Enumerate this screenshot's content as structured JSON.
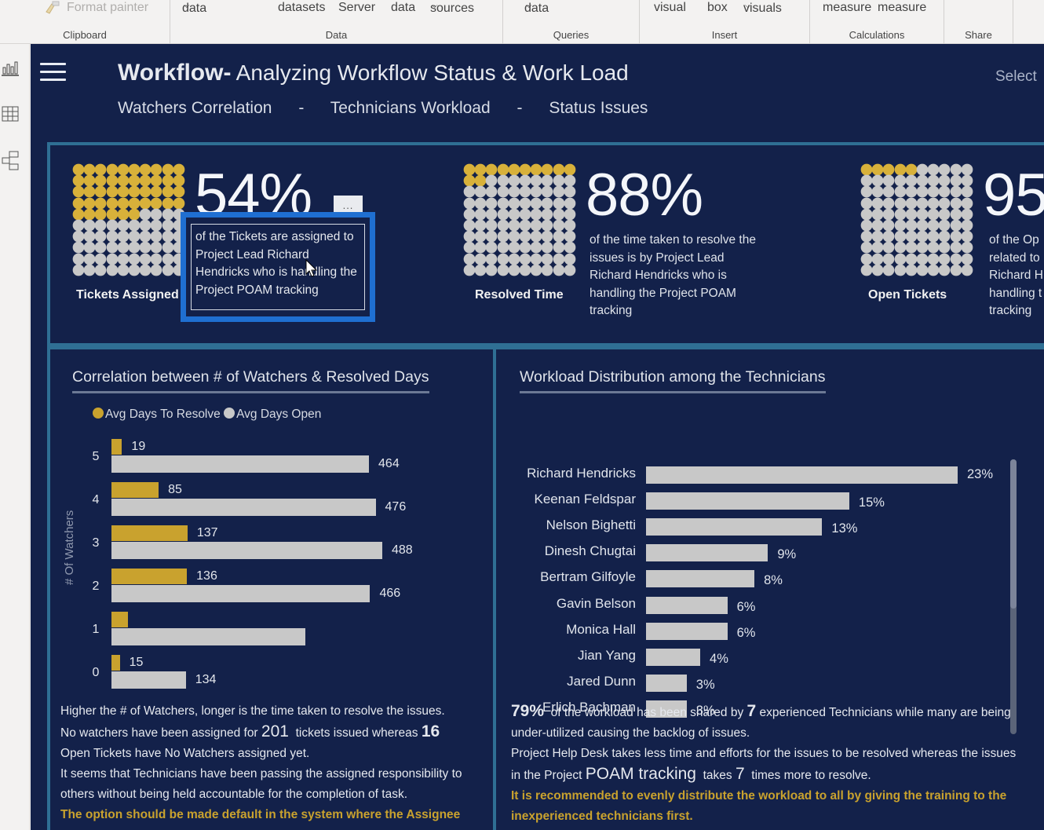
{
  "ribbon": {
    "groups": [
      {
        "label": "Clipboard",
        "items": [
          "Format painter"
        ]
      },
      {
        "label": "Data",
        "items": [
          "data",
          "datasets",
          "Server",
          "data",
          "sources"
        ]
      },
      {
        "label": "Queries",
        "items": [
          "data"
        ]
      },
      {
        "label": "Insert",
        "items": [
          "visual",
          "box",
          "visuals"
        ]
      },
      {
        "label": "Calculations",
        "items": [
          "measure",
          "measure"
        ]
      },
      {
        "label": "Share",
        "items": []
      }
    ]
  },
  "leftnav": {
    "items": [
      {
        "name": "report-view",
        "icon": "bar-chart-icon"
      },
      {
        "name": "data-view",
        "icon": "table-icon"
      },
      {
        "name": "model-view",
        "icon": "model-icon"
      }
    ]
  },
  "header": {
    "title_bold": "Workflow-",
    "title_rest": " Analyzing Workflow Status & Work Load",
    "nav": [
      "Watchers Correlation",
      "-",
      "Technicians Workload",
      "-",
      "Status Issues"
    ],
    "select_label": "Select"
  },
  "kpis": [
    {
      "label": "Tickets Assigned",
      "value": "54%",
      "waffle_filled_cells": 46,
      "waffle_total_cells": 100,
      "description": "of the Tickets are assigned to Project Lead Richard Hendricks who is handling the Project POAM tracking"
    },
    {
      "label": "Resolved Time",
      "value": "88%",
      "waffle_filled_cells": 12,
      "waffle_total_cells": 100,
      "description": "of the time taken to resolve the issues is by Project Lead Richard Hendricks who is handling the Project POAM tracking"
    },
    {
      "label": "Open Tickets",
      "value": "95",
      "waffle_filled_cells": 5,
      "waffle_total_cells": 100,
      "description_lines": [
        "of the Op",
        "related to",
        "Richard H",
        "handling t",
        "tracking"
      ]
    }
  ],
  "more_options_label": "...",
  "colors": {
    "background": "#13214a",
    "accent_border": "#2f6f94",
    "gold": "#c9a22e",
    "grey": "#c8c8c8",
    "focus_blue": "#1f6fd1"
  },
  "chart_data": [
    {
      "type": "bar",
      "orientation": "horizontal",
      "title": "Correlation between # of Watchers & Resolved Days",
      "ylabel": "# Of Watchers",
      "xlabel": "",
      "categories": [
        "5",
        "4",
        "3",
        "2",
        "1",
        "0"
      ],
      "series": [
        {
          "name": "Avg Days To Resolve",
          "color": "#c9a22e",
          "values": [
            19,
            85,
            137,
            136,
            30,
            15
          ],
          "labels": [
            "19",
            "85",
            "137",
            "136",
            "",
            "15"
          ]
        },
        {
          "name": "Avg Days Open",
          "color": "#c8c8c8",
          "values": [
            464,
            476,
            488,
            466,
            350,
            134
          ],
          "labels": [
            "464",
            "476",
            "488",
            "466",
            "",
            "134"
          ]
        }
      ],
      "xlim": [
        0,
        500
      ],
      "legend": "top-left",
      "grid": false
    },
    {
      "type": "bar",
      "orientation": "horizontal",
      "title": "Workload Distribution among the Technicians",
      "categories": [
        "Richard Hendricks",
        "Keenan Feldspar",
        "Nelson Bighetti",
        "Dinesh Chugtai",
        "Bertram Gilfoyle",
        "Gavin Belson",
        "Monica Hall",
        "Jian Yang",
        "Jared Dunn",
        "Erlich Bachman"
      ],
      "values": [
        23,
        15,
        13,
        9,
        8,
        6,
        6,
        4,
        3,
        3
      ],
      "labels": [
        "23%",
        "15%",
        "13%",
        "9%",
        "8%",
        "6%",
        "6%",
        "4%",
        "3%",
        "3%"
      ],
      "unit": "%",
      "xlim": [
        0,
        23
      ],
      "grid": false
    }
  ],
  "notes_left": {
    "l1": "Higher the # of Watchers, longer is the time taken to resolve the issues.",
    "l2a": "No watchers have been assigned for ",
    "l2n1": "201",
    "l2b": "  tickets issued whereas ",
    "l2n2": "16",
    "l3": "Open Tickets have No Watchers assigned yet.",
    "l4": "It seems that Technicians have been passing the assigned responsibility to",
    "l5": "others without being held accountable for the completion of task.",
    "l6": "The option should be made default in the system where the Assignee"
  },
  "notes_right": {
    "l1n": "79%",
    "l1a": "  of the workload has been shared by ",
    "l1n2": "7",
    "l1b": " experienced Technicians while many are being",
    "l2": "under-utilized causing the backlog of issues.",
    "l3": "Project Help Desk takes less time and efforts for the issues to be resolved whereas the issues",
    "l4a": "in the Project ",
    "l4n": "POAM tracking",
    "l4b": "  takes ",
    "l4n2": "7",
    "l4c": "  times more to resolve.",
    "l5": "It is recommended to evenly distribute the workload to all by giving the training to the",
    "l6": "inexperienced technicians first."
  }
}
